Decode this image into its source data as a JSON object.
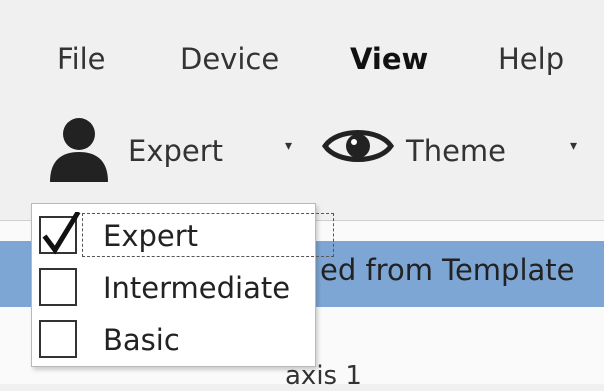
{
  "menubar": {
    "items": [
      {
        "label": "File"
      },
      {
        "label": "Device"
      },
      {
        "label": "View"
      },
      {
        "label": "Help"
      }
    ]
  },
  "toolbar": {
    "expert_label": "Expert",
    "theme_label": "Theme",
    "user_icon": "user-icon",
    "eye_icon": "eye-icon",
    "caret": "▾"
  },
  "content": {
    "banner_text": "ed from Template",
    "axis_text": "axis 1"
  },
  "dropdown": {
    "items": [
      {
        "label": "Expert",
        "checked": true
      },
      {
        "label": "Intermediate",
        "checked": false
      },
      {
        "label": "Basic",
        "checked": false
      }
    ]
  },
  "colors": {
    "banner": "#7ea6d4",
    "background": "#f0f0f0"
  }
}
